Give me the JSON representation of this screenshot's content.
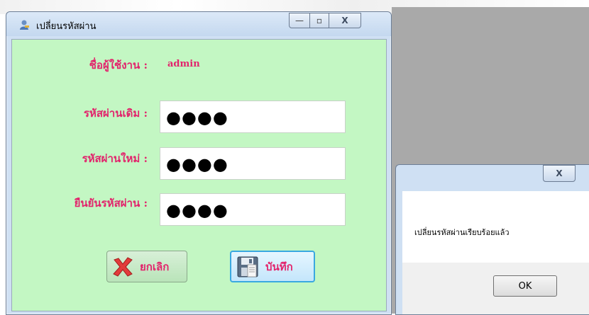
{
  "main_window": {
    "title": "เปลี่ยนรหัสผ่าน",
    "min_glyph": "—",
    "max_glyph": "▫",
    "close_glyph": "X"
  },
  "form": {
    "username_label": "ชื่อผู้ใช้งาน :",
    "username_value": "admin",
    "old_password_label": "รหัสผ่านเดิม :",
    "old_password_value": "●●●●",
    "new_password_label": "รหัสผ่านใหม่ :",
    "new_password_value": "●●●●",
    "confirm_password_label": "ยืนยันรหัสผ่าน :",
    "confirm_password_value": "●●●●"
  },
  "buttons": {
    "cancel_label": "ยกเลิก",
    "save_label": "บันทึก"
  },
  "message_box": {
    "close_glyph": "X",
    "text": "เปลี่ยนรหัสผ่านเรียบร้อยแล้ว",
    "ok_label": "OK"
  },
  "colors": {
    "form_background": "#c3f7c3",
    "label_color": "#e2246c",
    "window_frame": "#cfe0f3",
    "desktop": "#a9a9a9"
  },
  "icons": {
    "app": "user-key-icon",
    "cancel": "red-x-icon",
    "save": "floppy-disk-icon"
  }
}
